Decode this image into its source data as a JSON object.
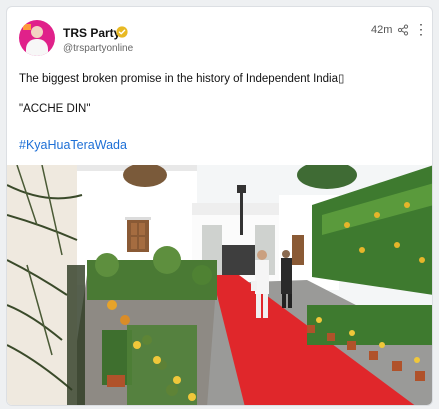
{
  "post": {
    "account_name": "TRS Party",
    "handle": "@trspartyonline",
    "time": "42m",
    "text_line1": "The biggest broken promise in the history of Independent India",
    "text_line1_glyph": "▯",
    "text_line2": "\"ACCHE DIN\"",
    "hashtag": "#KyaHuaTeraWada",
    "more_label": "⋮",
    "icons": {
      "verified": "verified-badge-icon",
      "share": "share-icon",
      "more": "more-options-icon"
    },
    "colors": {
      "verified": "#e8b923",
      "hashtag": "#1d6fd6",
      "avatar_bg": "#e0218a",
      "carpet": "#e0272b"
    }
  }
}
